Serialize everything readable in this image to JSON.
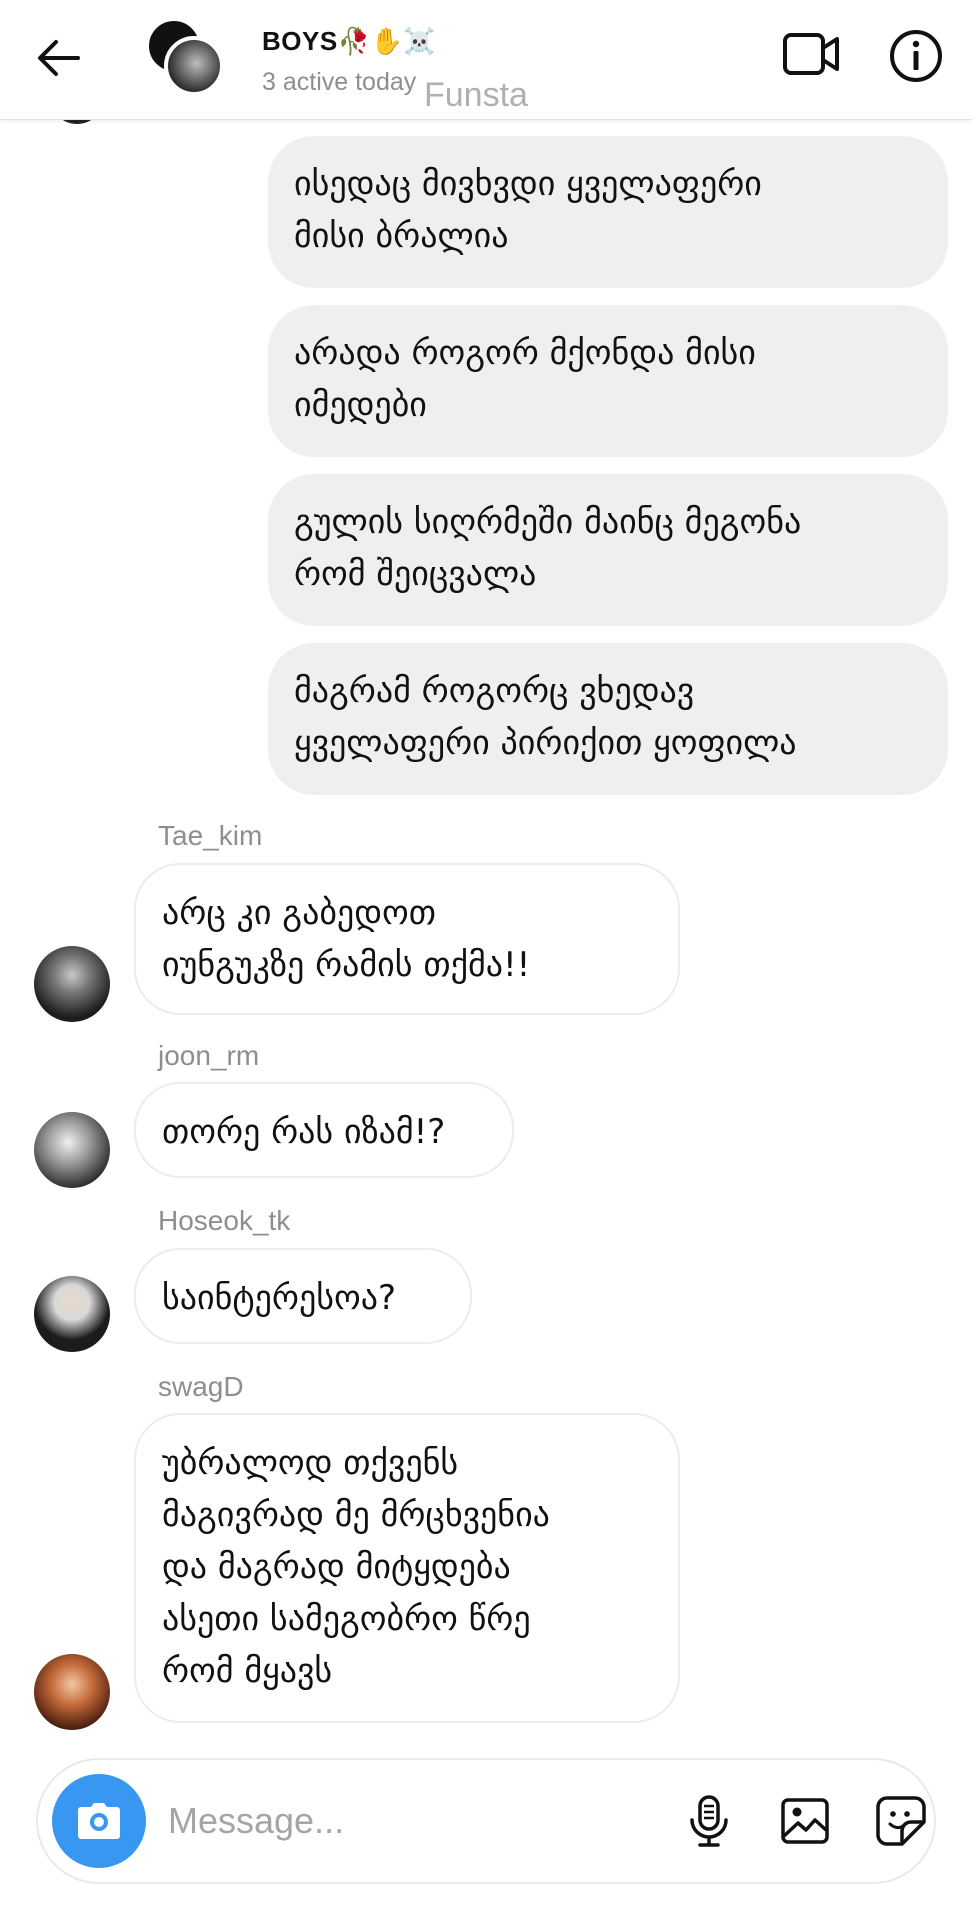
{
  "header": {
    "title": "BOYS🥀✋☠️",
    "subtitle": "3 active today",
    "watermark": "Funsta"
  },
  "messages": [
    {
      "direction": "outgoing",
      "text": "ისედაც მივხვდი ყველაფერი\nმისი ბრალია"
    },
    {
      "direction": "outgoing",
      "text": "არადა როგორ მქონდა მისი\nიმედები"
    },
    {
      "direction": "outgoing",
      "text": "გულის სიღრმეში მაინც მეგონა\nრომ შეიცვალა"
    },
    {
      "direction": "outgoing",
      "text": "მაგრამ როგორც ვხედავ\nყველაფერი პირიქით ყოფილა"
    },
    {
      "direction": "incoming",
      "sender": "Tae_kim",
      "text": "არც კი გაბედოთ\nიუნგუკზე რამის თქმა!!"
    },
    {
      "direction": "incoming",
      "sender": "joon_rm",
      "text": "თორე რას იზამ!?"
    },
    {
      "direction": "incoming",
      "sender": "Hoseok_tk",
      "text": "საინტერესოა?"
    },
    {
      "direction": "incoming",
      "sender": "swagD",
      "text": "უბრალოდ თქვენს\nმაგივრად მე მრცხვენია\nდა მაგრად მიტყდება\nასეთი სამეგობრო წრე\nრომ მყავს"
    }
  ],
  "composer": {
    "placeholder": "Message..."
  },
  "icons": {
    "back": "arrow-left-icon",
    "video": "video-call-icon",
    "info": "info-icon",
    "camera": "camera-icon",
    "mic": "microphone-icon",
    "gallery": "image-gallery-icon",
    "sticker": "sticker-icon"
  },
  "colors": {
    "accent": "#3897f0",
    "outgoing_bubble": "#efeff1",
    "incoming_border": "#ececec",
    "muted_text": "#8e8e8e"
  }
}
